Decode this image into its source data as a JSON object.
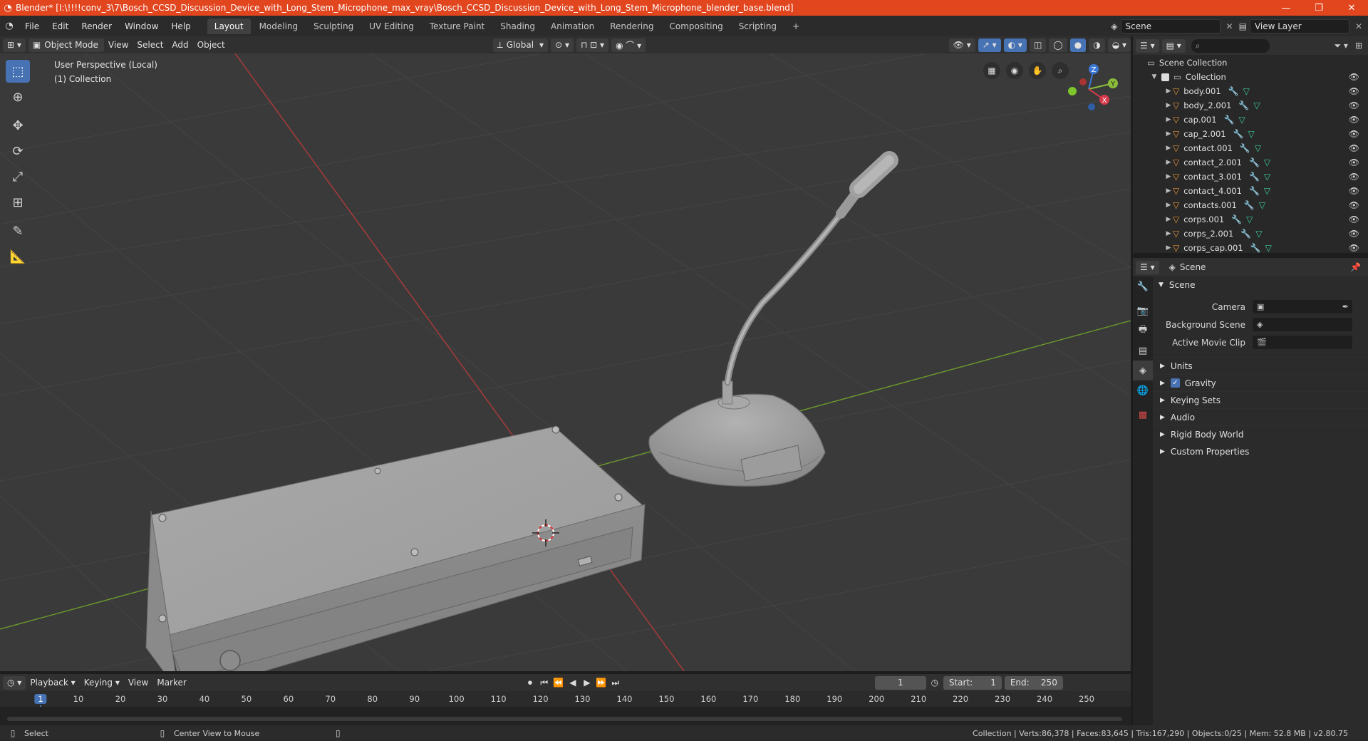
{
  "window": {
    "title": "Blender* [I:\\!!!!conv_3\\7\\Bosch_CCSD_Discussion_Device_with_Long_Stem_Microphone_max_vray\\Bosch_CCSD_Discussion_Device_with_Long_Stem_Microphone_blender_base.blend]",
    "min": "—",
    "max": "❐",
    "close": "✕"
  },
  "menu": [
    "File",
    "Edit",
    "Render",
    "Window",
    "Help"
  ],
  "workspaces": [
    "Layout",
    "Modeling",
    "Sculpting",
    "UV Editing",
    "Texture Paint",
    "Shading",
    "Animation",
    "Rendering",
    "Compositing",
    "Scripting"
  ],
  "workspace_add": "+",
  "scene_name": "Scene",
  "view_layer": "View Layer",
  "viewport": {
    "mode": "Object Mode",
    "menus": [
      "View",
      "Select",
      "Add",
      "Object"
    ],
    "transform": "Global",
    "overlay_line1": "User Perspective (Local)",
    "overlay_line2": "(1) Collection",
    "gizmo": {
      "x": "X",
      "y": "Y",
      "z": "Z"
    }
  },
  "outliner": {
    "root": "Scene Collection",
    "collection": "Collection",
    "objects": [
      "body.001",
      "body_2.001",
      "cap.001",
      "cap_2.001",
      "contact.001",
      "contact_2.001",
      "contact_3.001",
      "contact_4.001",
      "contacts.001",
      "corps.001",
      "corps_2.001",
      "corps_cap.001"
    ]
  },
  "properties": {
    "header": "Scene",
    "panel_title": "Scene",
    "fields": [
      {
        "label": "Camera",
        "value": ""
      },
      {
        "label": "Background Scene",
        "value": ""
      },
      {
        "label": "Active Movie Clip",
        "value": ""
      }
    ],
    "subpanels": [
      "Units",
      "Gravity",
      "Keying Sets",
      "Audio",
      "Rigid Body World",
      "Custom Properties"
    ],
    "gravity_checked": true
  },
  "timeline": {
    "menus": [
      "Playback",
      "Keying",
      "View",
      "Marker"
    ],
    "current_frame": "1",
    "start_label": "Start:",
    "start": "1",
    "end_label": "End:",
    "end": "250",
    "ticks": [
      "1",
      "10",
      "20",
      "30",
      "40",
      "50",
      "60",
      "70",
      "80",
      "90",
      "100",
      "110",
      "120",
      "130",
      "140",
      "150",
      "160",
      "170",
      "180",
      "190",
      "200",
      "210",
      "220",
      "230",
      "240",
      "250"
    ]
  },
  "status": {
    "select": "Select",
    "center_view": "Center View to Mouse",
    "stats": "Collection | Verts:86,378 | Faces:83,645 | Tris:167,290 | Objects:0/25 | Mem: 52.8 MB | v2.80.75"
  },
  "colors": {
    "titlebar": "#e2461f",
    "accent": "#4772b3",
    "x_axis": "#c0392b",
    "y_axis": "#7aa33a"
  }
}
